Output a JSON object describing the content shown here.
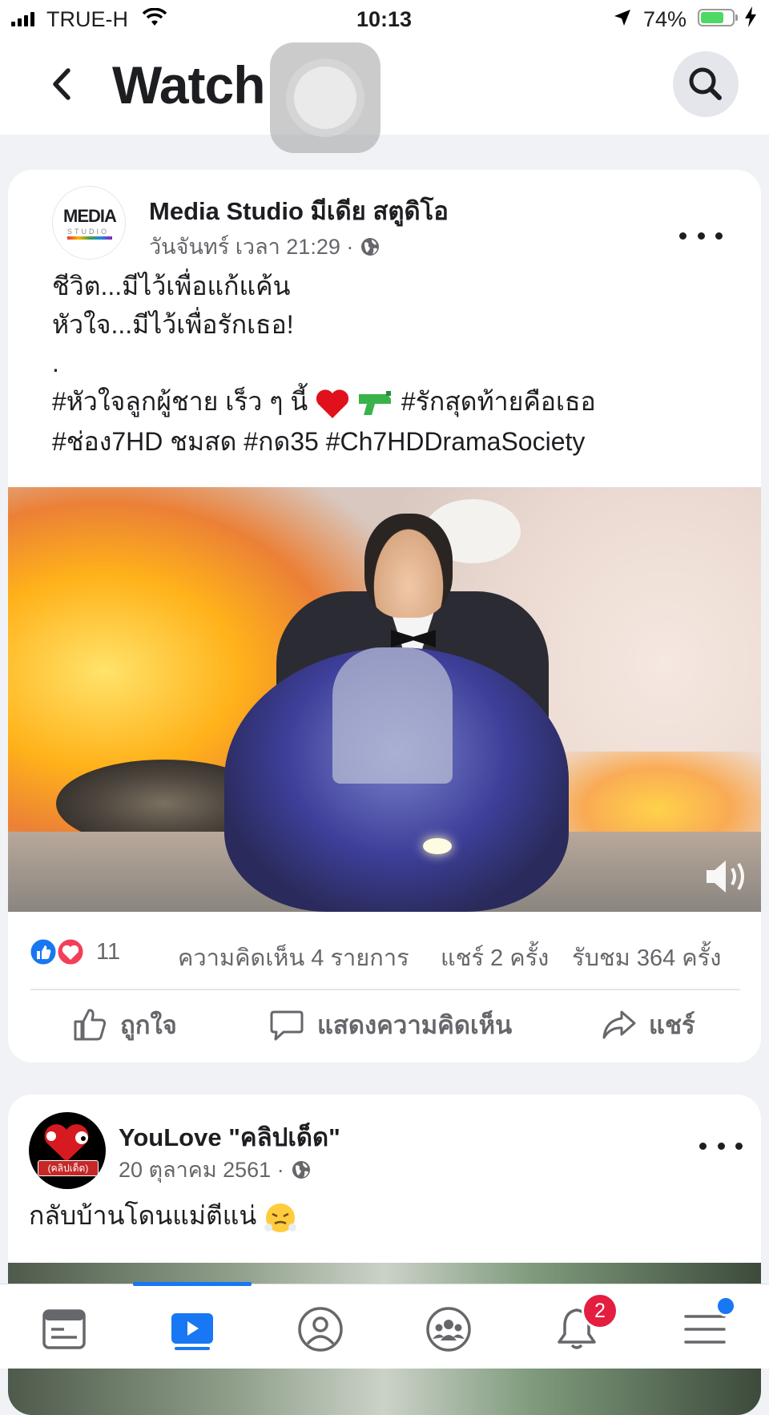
{
  "status_bar": {
    "carrier": "TRUE-H",
    "time": "10:13",
    "battery": "74%",
    "battery_level": 0.74
  },
  "header": {
    "title": "Watch",
    "back_icon": "chevron-left-icon",
    "search_icon": "search-icon"
  },
  "posts": [
    {
      "author": "Media Studio มีเดีย สตูดิโอ",
      "timestamp": "วันจันทร์ เวลา 21:29 ·",
      "avatar_text": "MEDIA",
      "avatar_sub": "STUDIO",
      "text_lines": [
        "ชีวิต...มีไว้เพื่อแก้แค้น",
        "หัวใจ...มีไว้เพื่อรักเธอ!",
        ".",
        "#หัวใจลูกผู้ชาย เร็ว ๆ นี้",
        "#รักสุดท้ายคือเธอ",
        "#ช่อง7HD ชมสด #กด35 #Ch7HDDramaSociety"
      ],
      "reaction_count": "11",
      "comments": "ความคิดเห็น 4 รายการ",
      "shares": "แชร์ 2 ครั้ง",
      "views": "รับชม 364 ครั้ง",
      "actions": {
        "like": "ถูกใจ",
        "comment": "แสดงความคิดเห็น",
        "share": "แชร์"
      }
    },
    {
      "author": "YouLove \"คลิปเด็ด\"",
      "timestamp": "20 ตุลาคม 2561 ·",
      "avatar_label": "(คลิปเด็ด)",
      "text": "กลับบ้านโดนแม่ตีแน่"
    }
  ],
  "tabbar": {
    "notifications_badge": "2",
    "tabs": [
      "news-feed-icon",
      "watch-icon",
      "profile-icon",
      "groups-icon",
      "bell-icon",
      "menu-icon"
    ]
  }
}
